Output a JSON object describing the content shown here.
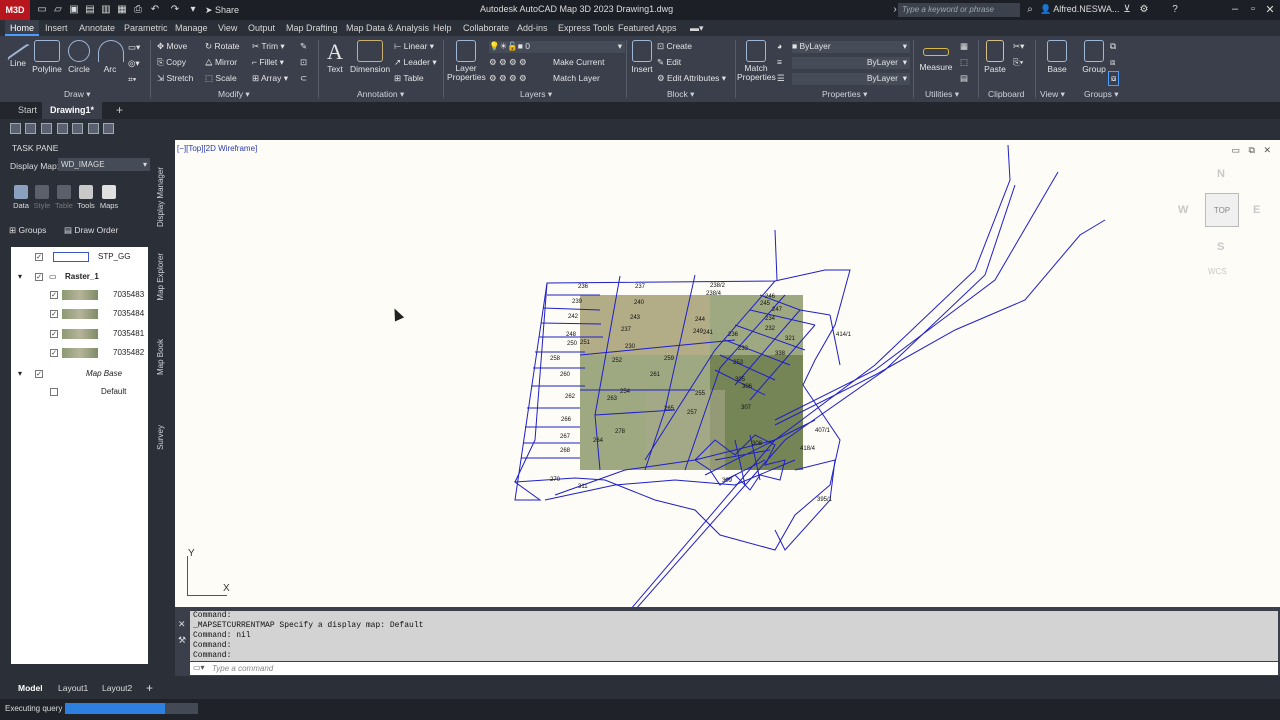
{
  "app_badge": "M3D",
  "title": "Autodesk AutoCAD Map 3D 2023    Drawing1.dwg",
  "share_label": "Share",
  "search_placeholder": "Type a keyword or phrase",
  "user": "Alfred.NESWA...",
  "ribbon_tabs": [
    "Home",
    "Insert",
    "Annotate",
    "Parametric",
    "Manage",
    "View",
    "Output",
    "Map Drafting",
    "Map Data & Analysis",
    "Help",
    "Collaborate",
    "Add-ins",
    "Express Tools",
    "Featured Apps"
  ],
  "ribbon": {
    "draw": {
      "line": "Line",
      "polyline": "Polyline",
      "circle": "Circle",
      "arc": "Arc",
      "panel": "Draw"
    },
    "modify": {
      "move": "Move",
      "copy": "Copy",
      "stretch": "Stretch",
      "rotate": "Rotate",
      "mirror": "Mirror",
      "scale": "Scale",
      "trim": "Trim",
      "fillet": "Fillet",
      "array": "Array",
      "panel": "Modify"
    },
    "annotation": {
      "text": "Text",
      "dimension": "Dimension",
      "linear": "Linear",
      "leader": "Leader",
      "table": "Table",
      "panel": "Annotation"
    },
    "layers": {
      "layer_properties": "Layer Properties",
      "current_layer": "0",
      "make_current": "Make Current",
      "match_layer": "Match Layer",
      "panel": "Layers"
    },
    "block": {
      "insert": "Insert",
      "create": "Create",
      "edit": "Edit",
      "edit_attributes": "Edit Attributes",
      "panel": "Block"
    },
    "properties": {
      "match": "Match Properties",
      "color": "ByLayer",
      "linetype": "ByLayer",
      "lineweight": "ByLayer",
      "panel": "Properties"
    },
    "utilities": {
      "measure": "Measure",
      "panel": "Utilities"
    },
    "clipboard": {
      "paste": "Paste",
      "panel": "Clipboard"
    },
    "view": {
      "base": "Base",
      "panel": "View"
    },
    "groups": {
      "group": "Group",
      "panel": "Groups"
    }
  },
  "doc_tabs": [
    "Start",
    "Drawing1*"
  ],
  "taskpane": {
    "title": "TASK PANE",
    "display_map_label": "Display Map:",
    "display_map_value": "WD_IMAGE",
    "buttons": [
      "Data",
      "Style",
      "Table",
      "Tools",
      "Maps"
    ],
    "groups_label": "Groups",
    "draw_order_label": "Draw Order",
    "layers": [
      {
        "name": "STP_GG",
        "checked": true
      },
      {
        "name": "Raster_1",
        "checked": true,
        "group": true
      },
      {
        "name": "7035483",
        "checked": true
      },
      {
        "name": "7035484",
        "checked": true
      },
      {
        "name": "7035481",
        "checked": true
      },
      {
        "name": "7035482",
        "checked": true
      },
      {
        "name": "Map Base",
        "checked": true,
        "group": true
      },
      {
        "name": "Default",
        "checked": false
      }
    ],
    "vertical_tabs": [
      "Display Manager",
      "Map Explorer",
      "Map Book",
      "Survey"
    ]
  },
  "viewport": {
    "label": "[−][Top][2D Wireframe]",
    "compass": {
      "n": "N",
      "s": "S",
      "e": "E",
      "w": "W",
      "top": "TOP",
      "wcs": "WCS"
    },
    "ucs": {
      "x": "X",
      "y": "Y"
    },
    "parcels": [
      "236",
      "237",
      "238/2",
      "238/4",
      "239",
      "240",
      "242",
      "243",
      "244",
      "241",
      "246",
      "245",
      "247",
      "248",
      "249",
      "250",
      "251",
      "237",
      "230",
      "232",
      "258",
      "259",
      "260",
      "261",
      "263",
      "262",
      "266",
      "267",
      "268",
      "270",
      "311",
      "264",
      "278",
      "305",
      "306",
      "307",
      "308",
      "309",
      "407/1",
      "395/1",
      "418/4",
      "414/1",
      "321",
      "338",
      "233",
      "234",
      "236",
      "253",
      "252",
      "254",
      "255",
      "257",
      "265"
    ]
  },
  "command": {
    "history": [
      "Command:",
      "_MAPSETCURRENTMAP Specify a display map: Default",
      "Command: nil",
      "Command:",
      "Command:"
    ],
    "placeholder": "Type a command"
  },
  "layout_tabs": [
    "Model",
    "Layout1",
    "Layout2"
  ],
  "status": {
    "text": "Executing query",
    "progress": 0.75
  }
}
